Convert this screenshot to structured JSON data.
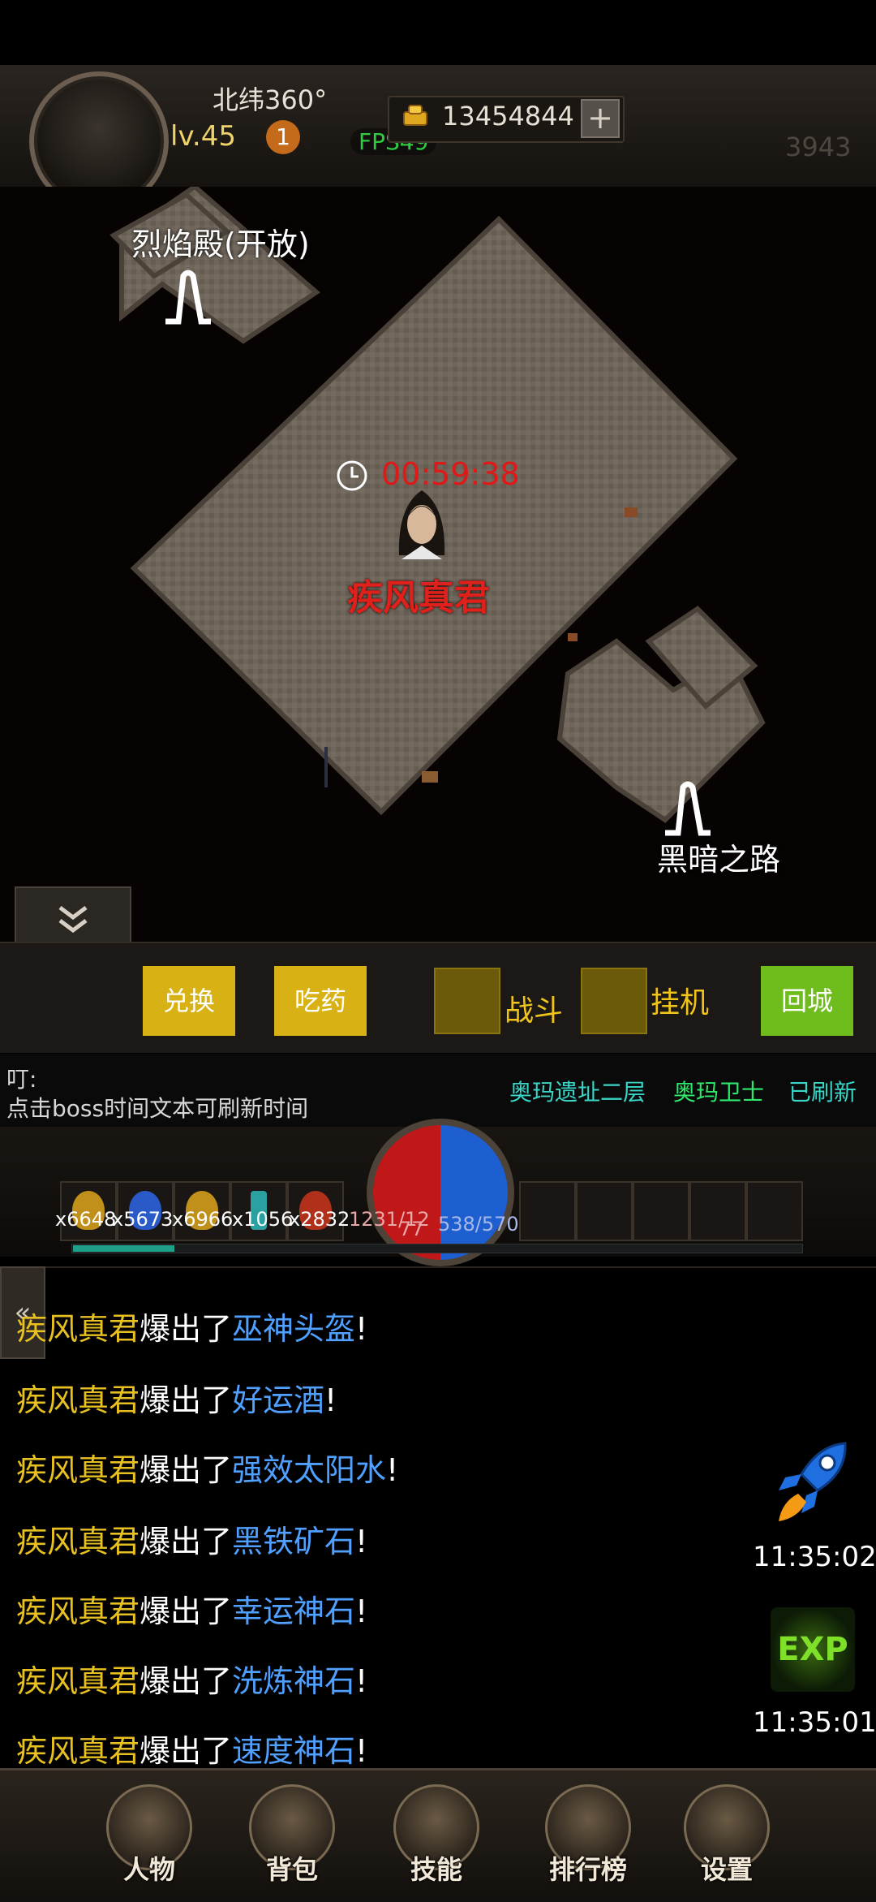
{
  "header": {
    "latitude": "北纬360°",
    "level": "lv.45",
    "level_badge": "1",
    "fps": "FPS49",
    "gold": "13454844",
    "plus": "+",
    "score": "3943"
  },
  "map": {
    "portal_top_label": "烈焰殿(开放)",
    "portal_bottom_label": "黑暗之路",
    "boss_timer": "00:59:38",
    "boss_name": "疾风真君"
  },
  "actions": {
    "exchange": "兑换",
    "eat_potion": "吃药",
    "fight": "战斗",
    "auto": "挂机",
    "return_city": "回城"
  },
  "info": {
    "ding": "叮:",
    "hint": "点击boss时间文本可刷新时间",
    "location": "奥玛遗址二层",
    "monster": "奥玛卫士",
    "status": "已刷新"
  },
  "hud": {
    "potions": [
      "x6648",
      "x5673",
      "x6966",
      "x1056",
      "x2832"
    ],
    "hp": "1231/12",
    "hp_extra": "77",
    "mp": "538/570",
    "exp_progress": 0.14
  },
  "chat": {
    "lines": [
      {
        "name": "疾风真君",
        "verb": "爆出了",
        "item": "巫神头盔"
      },
      {
        "name": "疾风真君",
        "verb": "爆出了",
        "item": "好运酒"
      },
      {
        "name": "疾风真君",
        "verb": "爆出了",
        "item": "强效太阳水"
      },
      {
        "name": "疾风真君",
        "verb": "爆出了",
        "item": "黑铁矿石"
      },
      {
        "name": "疾风真君",
        "verb": "爆出了",
        "item": "幸运神石"
      },
      {
        "name": "疾风真君",
        "verb": "爆出了",
        "item": "洗炼神石"
      },
      {
        "name": "疾风真君",
        "verb": "爆出了",
        "item": "速度神石"
      }
    ],
    "exclaim": "!",
    "rocket_time": "11:35:02",
    "exp_time": "11:35:01",
    "exp_label": "EXP",
    "sidetab": "«"
  },
  "nav": {
    "character": "人物",
    "bag": "背包",
    "skills": "技能",
    "ranking": "排行榜",
    "settings": "设置"
  },
  "colors": {
    "gold_button": "#d8b114",
    "green_button": "#6fbd1c",
    "boss_red": "#e0201a",
    "item_blue": "#4fa0ff",
    "name_yellow": "#e8c020"
  }
}
